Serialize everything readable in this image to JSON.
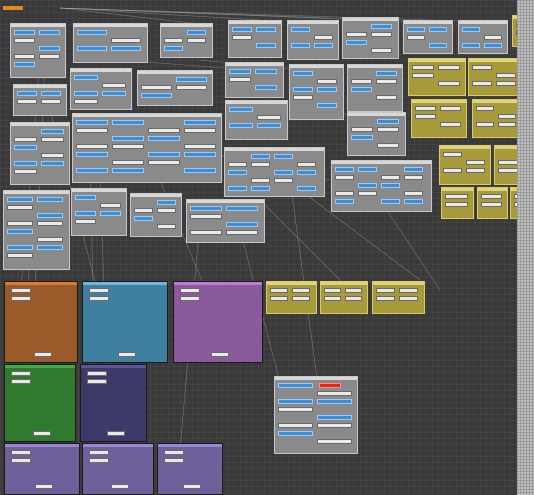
{
  "canvas": {
    "name": "node-graph-canvas",
    "palette": {
      "background": "#3a3a3a",
      "gray_panel": "#8a8a8a",
      "yellow_panel": "#a79a3a",
      "orange_frame": "#9a5a2a",
      "blue_frame": "#3f7f9f",
      "purple_frame": "#8a5a9a",
      "green_frame": "#2f7a2f",
      "indigo_frame": "#3d3a6a",
      "violet_frame": "#6f5f9a",
      "node_blue": "#3b8fd9",
      "node_white": "#e9e9e9",
      "node_red": "#e2261b",
      "accent_tag": "#e8871a"
    }
  }
}
